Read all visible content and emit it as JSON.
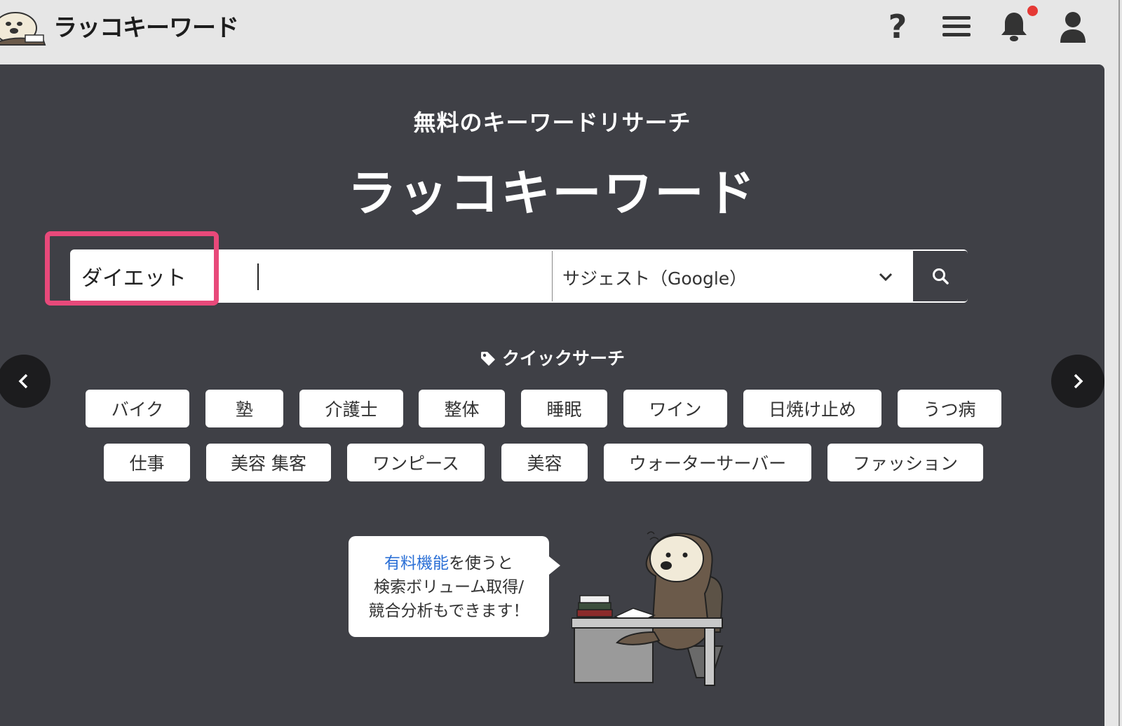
{
  "header": {
    "logo_text": "ラッコキーワード",
    "icons": [
      "help-icon",
      "menu-icon",
      "bell-icon",
      "user-icon"
    ],
    "help_glyph": "?",
    "notification_color": "#e53935"
  },
  "hero": {
    "subtitle": "無料のキーワードリサーチ",
    "title": "ラッコキーワード",
    "background": "#3f4046"
  },
  "search": {
    "value": "ダイエット",
    "mode_selected": "サジェスト（Google）",
    "highlight_color": "#e8497a"
  },
  "quick_search": {
    "title": "クイックサーチ",
    "row1": [
      "バイク",
      "塾",
      "介護士",
      "整体",
      "睡眠",
      "ワイン",
      "日焼け止め",
      "うつ病"
    ],
    "row2": [
      "仕事",
      "美容 集客",
      "ワンピース",
      "美容",
      "ウォーターサーバー",
      "ファッション"
    ]
  },
  "promo": {
    "link_text": "有料機能",
    "line1_rest": "を使うと",
    "line2": "検索ボリューム取得/",
    "line3": "競合分析もできます！"
  },
  "colors": {
    "accent_link": "#2a6fd6",
    "extension_icon": "#2f7de1"
  }
}
